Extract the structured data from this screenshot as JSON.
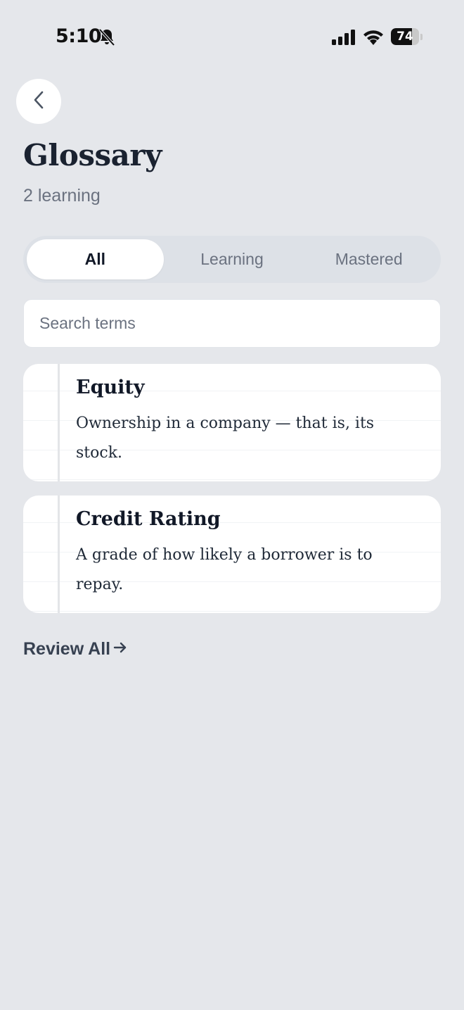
{
  "status_bar": {
    "time": "5:10",
    "battery_level": "74",
    "battery_percent": 74
  },
  "header": {
    "back_icon": "chevron-left-icon",
    "title": "Glossary",
    "subtitle": "2 learning"
  },
  "tabs": [
    {
      "label": "All",
      "active": true
    },
    {
      "label": "Learning",
      "active": false
    },
    {
      "label": "Mastered",
      "active": false
    }
  ],
  "search": {
    "placeholder": "Search terms",
    "value": ""
  },
  "terms": [
    {
      "term": "Equity",
      "definition": "Ownership in a company — that is, its stock."
    },
    {
      "term": "Credit Rating",
      "definition": "A grade of how likely a borrower is to repay."
    }
  ],
  "footer": {
    "review_label": "Review All",
    "review_icon": "arrow-right-icon"
  }
}
